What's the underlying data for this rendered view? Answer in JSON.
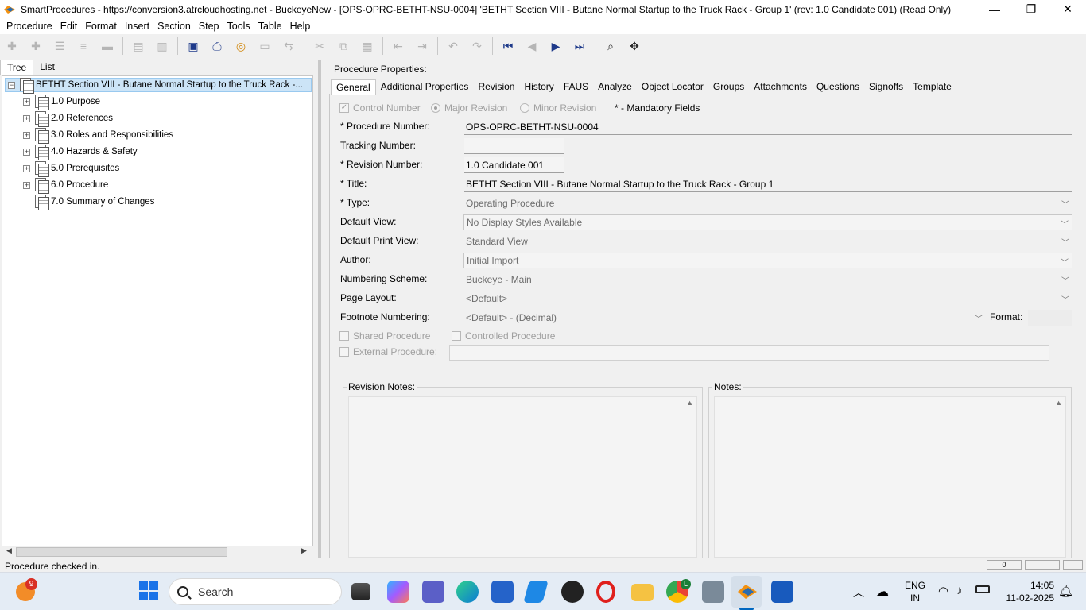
{
  "window": {
    "title": "SmartProcedures - https://conversion3.atrcloudhosting.net - BuckeyeNew - [OPS-OPRC-BETHT-NSU-0004] 'BETHT Section VIII - Butane Normal Startup to the Truck Rack - Group 1' (rev: 1.0 Candidate 001) (Read Only)",
    "minimize": "—",
    "restore": "❐",
    "close": "✕"
  },
  "menu": [
    "Procedure",
    "Edit",
    "Format",
    "Insert",
    "Section",
    "Step",
    "Tools",
    "Table",
    "Help"
  ],
  "left_tabs": [
    "Tree",
    "List"
  ],
  "tree": {
    "root": "BETHT Section VIII - Butane Normal Startup to the Truck Rack -...",
    "items": [
      {
        "label": "1.0 Purpose",
        "expandable": true
      },
      {
        "label": "2.0 References",
        "expandable": true
      },
      {
        "label": "3.0 Roles and Responsibilities",
        "expandable": true
      },
      {
        "label": "4.0 Hazards & Safety",
        "expandable": true
      },
      {
        "label": "5.0 Prerequisites",
        "expandable": true
      },
      {
        "label": "6.0 Procedure",
        "expandable": true
      },
      {
        "label": "7.0 Summary of Changes",
        "expandable": false
      }
    ]
  },
  "properties": {
    "heading": "Procedure Properties:",
    "tabs": [
      "General",
      "Additional Properties",
      "Revision",
      "History",
      "FAUS",
      "Analyze",
      "Object Locator",
      "Groups",
      "Attachments",
      "Questions",
      "Signoffs",
      "Template"
    ],
    "control_number": "Control Number",
    "major_revision": "Major Revision",
    "minor_revision": "Minor Revision",
    "mandatory_note": "* - Mandatory Fields",
    "fields": {
      "procedure_number_label": "* Procedure Number:",
      "procedure_number": "OPS-OPRC-BETHT-NSU-0004",
      "tracking_number_label": "Tracking Number:",
      "tracking_number": "",
      "revision_number_label": "* Revision Number:",
      "revision_number": "1.0 Candidate 001",
      "title_label": "* Title:",
      "title": "BETHT Section VIII - Butane Normal Startup to the Truck Rack - Group 1",
      "type_label": "* Type:",
      "type": "Operating Procedure",
      "default_view_label": "Default View:",
      "default_view": "No Display Styles Available",
      "default_print_view_label": "Default Print View:",
      "default_print_view": "Standard View",
      "author_label": "Author:",
      "author": "Initial Import",
      "numbering_scheme_label": "Numbering Scheme:",
      "numbering_scheme": "Buckeye - Main",
      "page_layout_label": "Page Layout:",
      "page_layout": "<Default>",
      "footnote_numbering_label": "Footnote Numbering:",
      "footnote_numbering": "<Default> - (Decimal)",
      "format_label": "Format:",
      "shared_procedure": "Shared Procedure",
      "controlled_procedure": "Controlled Procedure",
      "external_procedure": "External Procedure:"
    },
    "revision_notes_label": "Revision Notes:",
    "notes_label": "Notes:"
  },
  "status": {
    "text": "Procedure checked in.",
    "panel_value": "0"
  },
  "taskbar": {
    "search_placeholder": "Search",
    "notification_badge": "9",
    "chrome_badge": "L",
    "lang_top": "ENG",
    "lang_bottom": "IN",
    "time": "14:05",
    "date": "11-02-2025"
  },
  "colors": {
    "selection": "#cce4f7",
    "accent_toolbar": "#1e3a8a",
    "taskbar": "#e4ecf5"
  }
}
